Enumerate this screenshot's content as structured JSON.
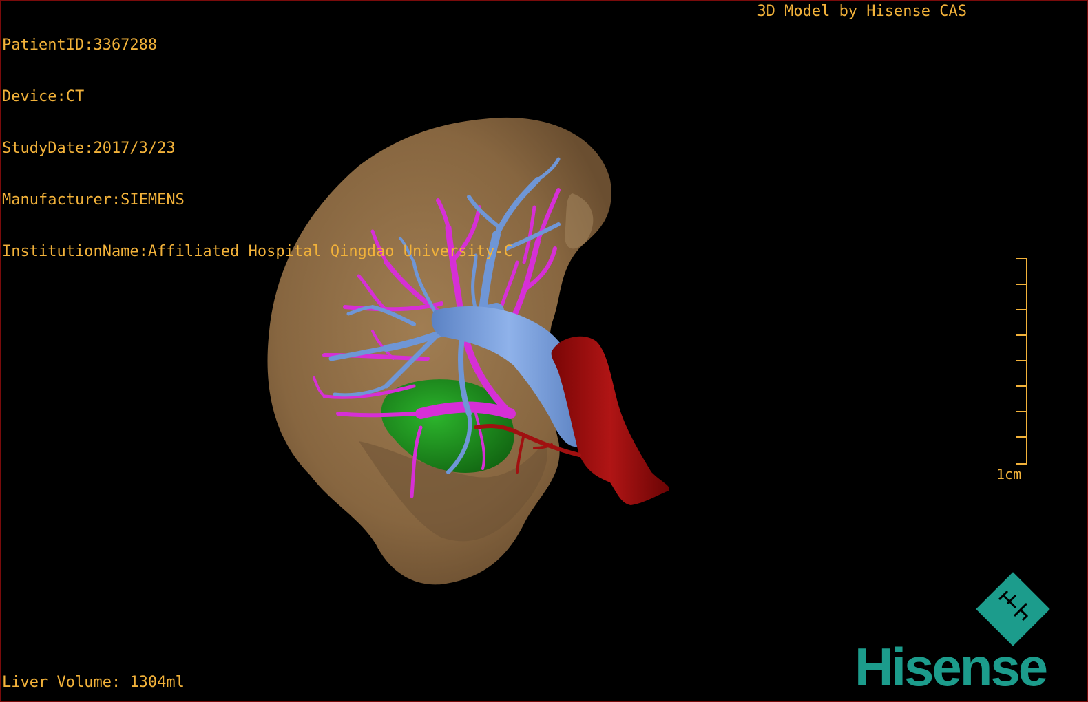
{
  "header": {
    "patient_id": "PatientID:3367288",
    "device": "Device:CT",
    "study_date": "StudyDate:2017/3/23",
    "manufacturer": "Manufacturer:SIEMENS",
    "institution": "InstitutionName:Affiliated Hospital Qingdao University-C"
  },
  "credit": "3D Model by Hisense CAS",
  "footer": {
    "liver_volume": "Liver Volume: 1304ml"
  },
  "scale_bar": {
    "label": "1cm"
  },
  "brand": {
    "logo_text": "Hisense",
    "emblem_letters": "HT"
  },
  "colors": {
    "text": "#f2b23a",
    "liver": "#8a6a45",
    "portal_vein": "#6f96d6",
    "hepatic_vein": "#d62fd6",
    "artery": "#a01010",
    "lesion": "#1d8a1d",
    "brand": "#1c9c8c"
  }
}
